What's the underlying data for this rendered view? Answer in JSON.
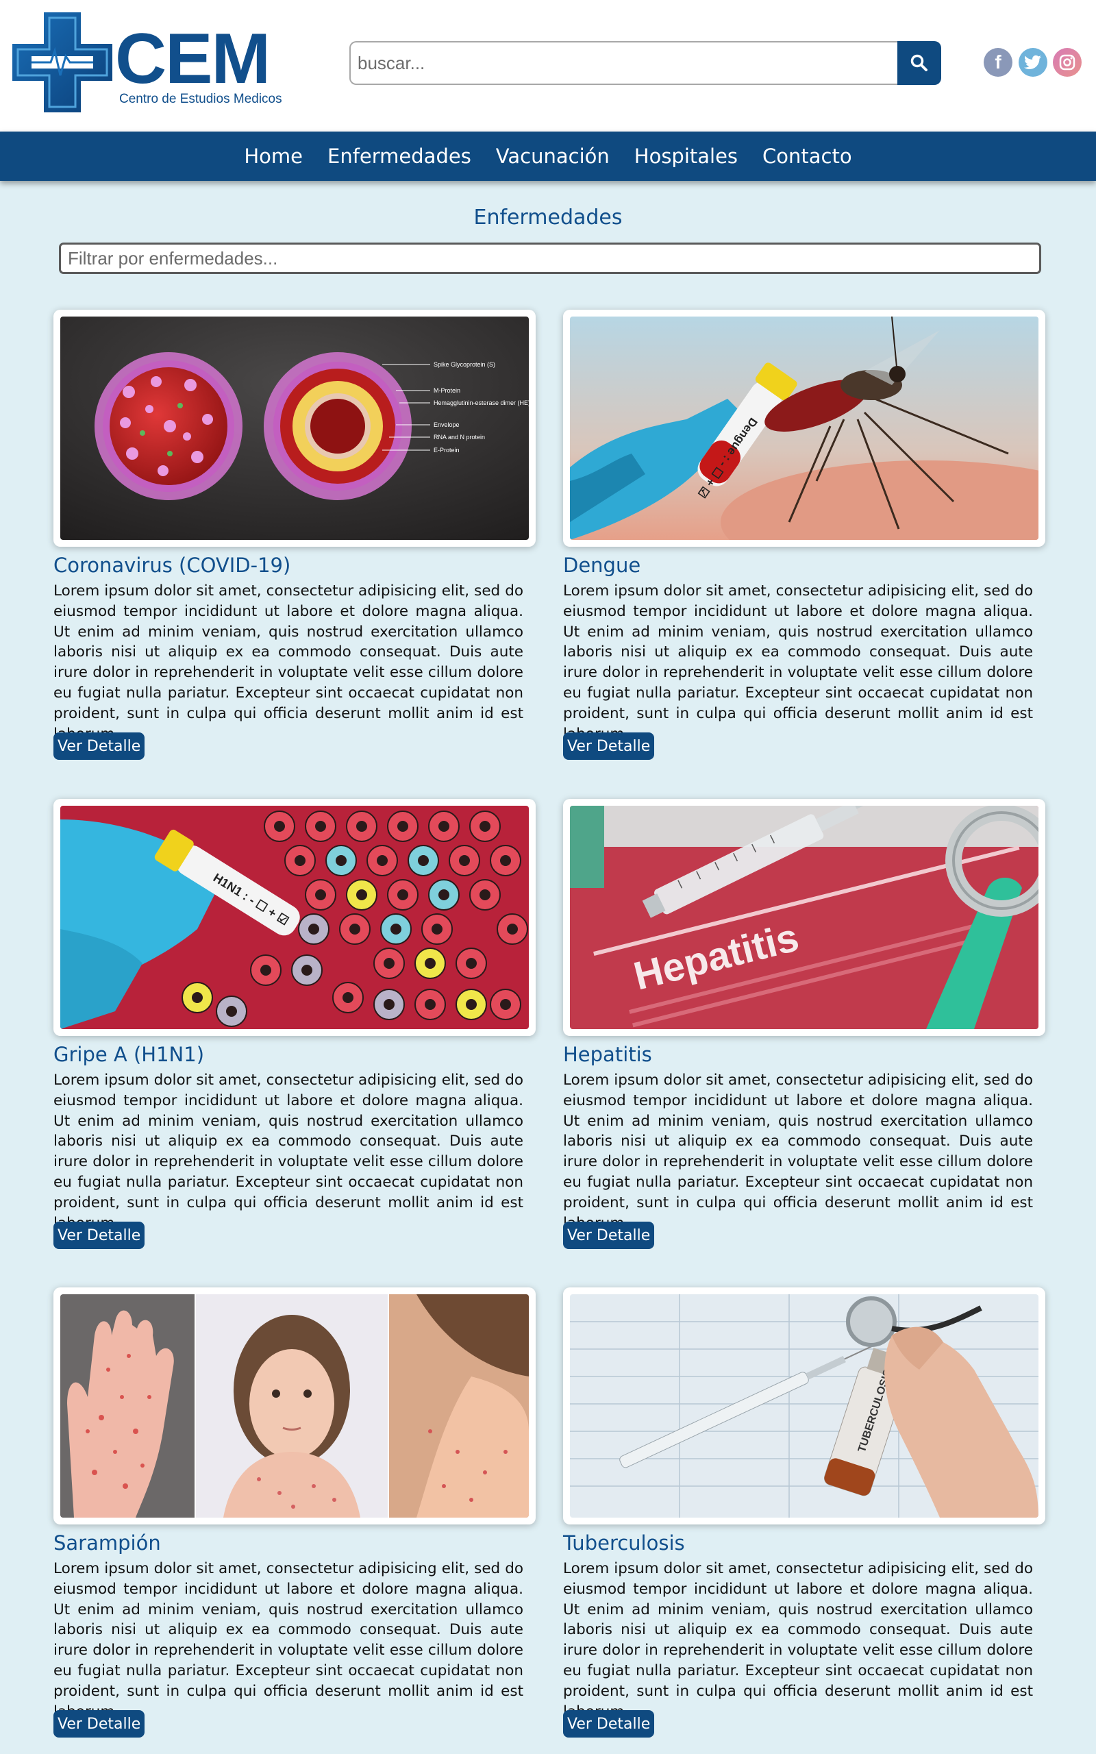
{
  "brand": {
    "name": "CEM",
    "subtitle": "Centro de Estudios Medicos",
    "color": "#114f8c"
  },
  "search": {
    "placeholder": "buscar...",
    "button_icon": "search-icon"
  },
  "social": [
    {
      "name": "facebook-icon",
      "glyph": "f",
      "color": "#8a98b8"
    },
    {
      "name": "twitter-icon",
      "glyph": "t",
      "color": "#6fb3db"
    },
    {
      "name": "instagram-icon",
      "glyph": "◎",
      "color": "#d77bb4"
    }
  ],
  "nav": {
    "items": [
      "Home",
      "Enfermedades",
      "Vacunación",
      "Hospitales",
      "Contacto"
    ],
    "background": "#0f4a80"
  },
  "main": {
    "title": "Enfermedades",
    "filter_placeholder": "Filtrar por enfermedades..."
  },
  "cards": [
    {
      "title": "Coronavirus (COVID-19)",
      "text": "Lorem ipsum dolor sit amet, consectetur adipisicing elit, sed do eiusmod tempor incididunt ut labore et dolore magna aliqua. Ut enim ad minim veniam, quis nostrud exercitation ullamco laboris nisi ut aliquip ex ea commodo consequat. Duis aute irure dolor in reprehenderit in voluptate velit esse cillum dolore eu fugiat nulla pariatur. Excepteur sint occaecat cupidatat non proident, sunt in culpa qui officia deserunt mollit anim id est laborum.",
      "button": "Ver Detalle",
      "image_labels": [
        "Spike Glycoprotein (S)",
        "M-Protein",
        "Hemagglutinin-esterase dimer (HE)",
        "Envelope",
        "RNA and N protein",
        "E-Protein"
      ]
    },
    {
      "title": "Dengue",
      "text": "Lorem ipsum dolor sit amet, consectetur adipisicing elit, sed do eiusmod tempor incididunt ut labore et dolore magna aliqua. Ut enim ad minim veniam, quis nostrud exercitation ullamco laboris nisi ut aliquip ex ea commodo consequat. Duis aute irure dolor in reprehenderit in voluptate velit esse cillum dolore eu fugiat nulla pariatur. Excepteur sint occaecat cupidatat non proident, sunt in culpa qui officia deserunt mollit anim id est laborum.",
      "button": "Ver Detalle",
      "image_labels": [
        "Dengue : - ☐ + ☑"
      ]
    },
    {
      "title": "Gripe A (H1N1)",
      "text": "Lorem ipsum dolor sit amet, consectetur adipisicing elit, sed do eiusmod tempor incididunt ut labore et dolore magna aliqua. Ut enim ad minim veniam, quis nostrud exercitation ullamco laboris nisi ut aliquip ex ea commodo consequat. Duis aute irure dolor in reprehenderit in voluptate velit esse cillum dolore eu fugiat nulla pariatur. Excepteur sint occaecat cupidatat non proident, sunt in culpa qui officia deserunt mollit anim id est laborum.",
      "button": "Ver Detalle",
      "image_labels": [
        "H1N1 : - ☐ + ☑"
      ]
    },
    {
      "title": "Hepatitis",
      "text": "Lorem ipsum dolor sit amet, consectetur adipisicing elit, sed do eiusmod tempor incididunt ut labore et dolore magna aliqua. Ut enim ad minim veniam, quis nostrud exercitation ullamco laboris nisi ut aliquip ex ea commodo consequat. Duis aute irure dolor in reprehenderit in voluptate velit esse cillum dolore eu fugiat nulla pariatur. Excepteur sint occaecat cupidatat non proident, sunt in culpa qui officia deserunt mollit anim id est laborum.",
      "button": "Ver Detalle",
      "image_labels": [
        "Hepatitis"
      ]
    },
    {
      "title": "Sarampión",
      "text": "Lorem ipsum dolor sit amet, consectetur adipisicing elit, sed do eiusmod tempor incididunt ut labore et dolore magna aliqua. Ut enim ad minim veniam, quis nostrud exercitation ullamco laboris nisi ut aliquip ex ea commodo consequat. Duis aute irure dolor in reprehenderit in voluptate velit esse cillum dolore eu fugiat nulla pariatur. Excepteur sint occaecat cupidatat non proident, sunt in culpa qui officia deserunt mollit anim id est laborum.",
      "button": "Ver Detalle",
      "image_labels": []
    },
    {
      "title": "Tuberculosis",
      "text": "Lorem ipsum dolor sit amet, consectetur adipisicing elit, sed do eiusmod tempor incididunt ut labore et dolore magna aliqua. Ut enim ad minim veniam, quis nostrud exercitation ullamco laboris nisi ut aliquip ex ea commodo consequat. Duis aute irure dolor in reprehenderit in voluptate velit esse cillum dolore eu fugiat nulla pariatur. Excepteur sint occaecat cupidatat non proident, sunt in culpa qui officia deserunt mollit anim id est laborum.",
      "button": "Ver Detalle",
      "image_labels": [
        "TUBERCULOSIS"
      ]
    }
  ]
}
